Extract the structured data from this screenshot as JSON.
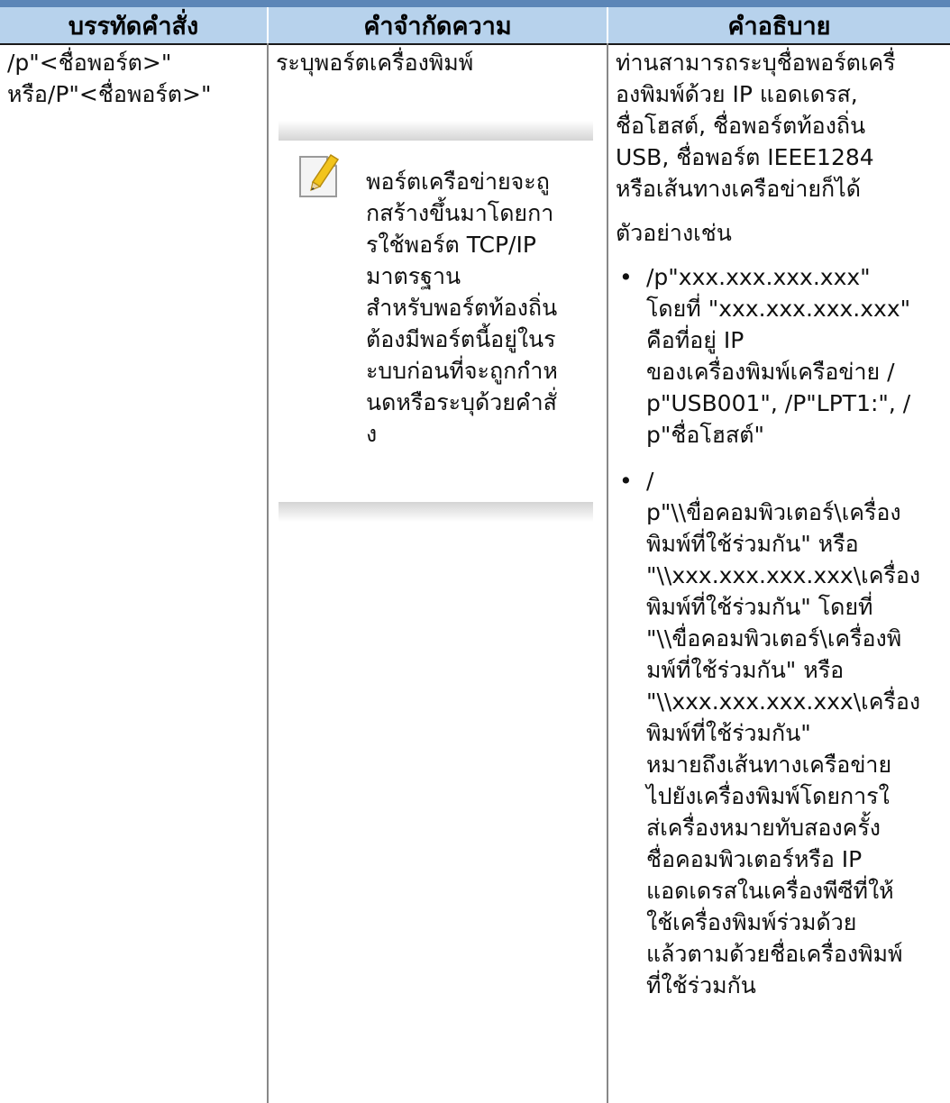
{
  "header": {
    "col1": "บรรทัดคำสั่ง",
    "col2": "คำจำกัดความ",
    "col3": "คำอธิบาย"
  },
  "row": {
    "command_line1": "/p\"<ชื่อพอร์ต>\"",
    "command_line2": "หรือ/P\"<ชื่อพอร์ต>\"",
    "definition": "ระบุพอร์ตเครื่องพิมพ์",
    "note_icon": "note-pencil-icon",
    "note_lines": [
      "พอร์ตเครือข่ายจะถู",
      "กสร้างขึ้นมาโดยกา",
      "รใช้พอร์ต TCP/IP",
      "มาตรฐาน",
      "สำหรับพอร์ตท้องถิ่น",
      "ต้องมีพอร์ตนี้อยู่ในร",
      "ะบบก่อนที่จะถูกกำห",
      "นดหรือระบุด้วยคำสั่",
      "ง"
    ],
    "description_lines": [
      "ท่านสามารถระบุชื่อพอร์ตเครื่",
      "องพิมพ์ด้วย IP แอดเดรส,",
      "ชื่อโฮสต์, ชื่อพอร์ตท้องถิ่น",
      "USB, ชื่อพอร์ต IEEE1284",
      "หรือเส้นทางเครือข่ายก็ได้"
    ],
    "example_label": "ตัวอย่างเช่น",
    "bullet_symbol": "•",
    "bullet1_lines": [
      "/p\"xxx.xxx.xxx.xxx\"",
      "โดยที่ \"xxx.xxx.xxx.xxx\"",
      "คือที่อยู่ IP",
      "ของเครื่องพิมพ์เครือข่าย /",
      "p\"USB001\", /P\"LPT1:\", /",
      "p\"ชื่อโฮสต์\""
    ],
    "bullet2_lines": [
      "/",
      "p\"\\\\ขื่อคอมพิวเตอร์\\เครื่อง",
      "พิมพ์ที่ใช้ร่วมกัน\" หรือ",
      "\"\\\\xxx.xxx.xxx.xxx\\เครื่อง",
      "พิมพ์ที่ใช้ร่วมกัน\" โดยที่",
      "\"\\\\ขื่อคอมพิวเตอร์\\เครื่องพิ",
      "มพ์ที่ใช้ร่วมกัน\" หรือ",
      "\"\\\\xxx.xxx.xxx.xxx\\เครื่อง",
      "พิมพ์ที่ใช้ร่วมกัน\"",
      "หมายถึงเส้นทางเครือข่าย",
      "ไปยังเครื่องพิมพ์โดยการใ",
      "ส่เครื่องหมายทับสองครั้ง",
      "ชื่อคอมพิวเตอร์หรือ IP",
      "แอดเดรสในเครื่องพีซีที่ให้",
      "ใช้เครื่องพิมพ์ร่วมด้วย",
      "แล้วตามด้วยชื่อเครื่องพิมพ์",
      "ที่ใช้ร่วมกัน"
    ]
  }
}
